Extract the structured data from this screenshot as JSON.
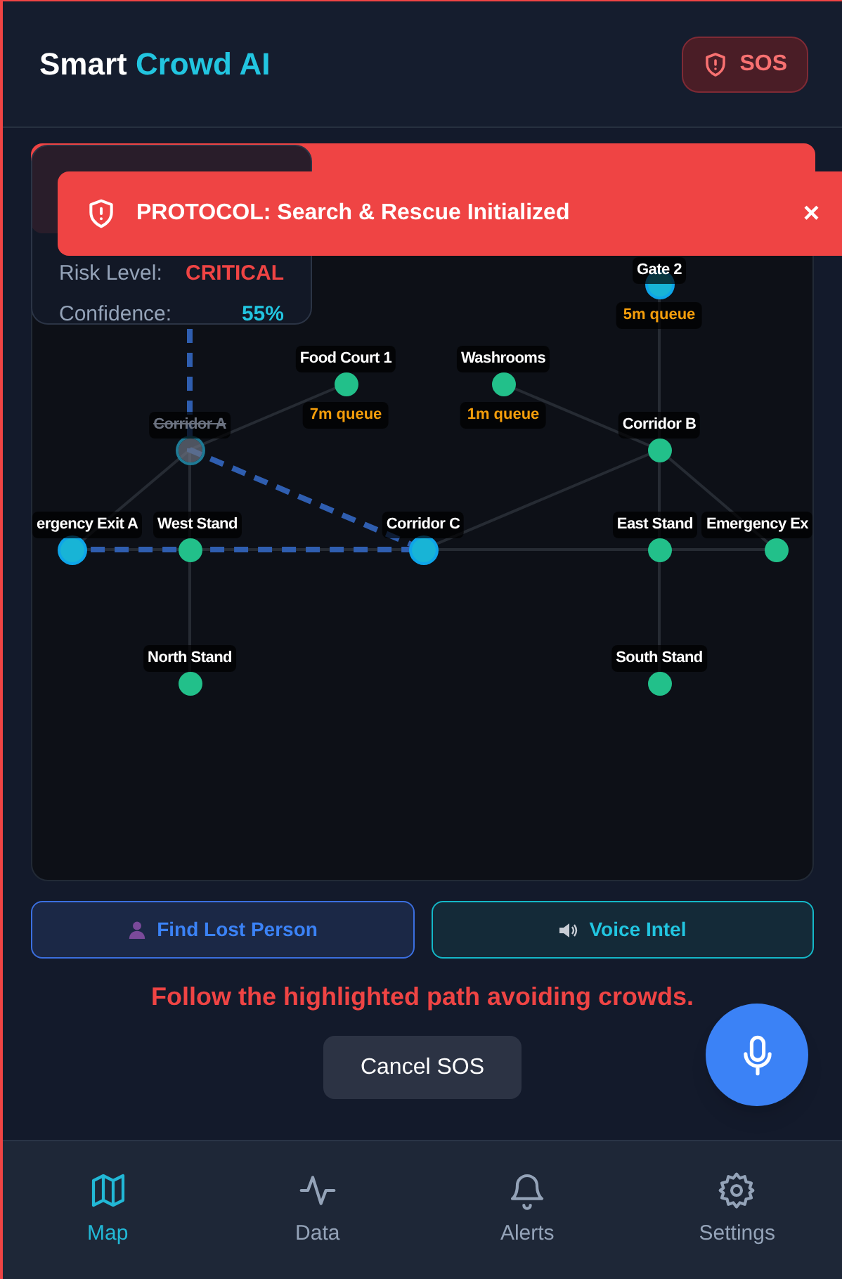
{
  "app_title": {
    "first": "Smart",
    "second": "Crowd AI"
  },
  "sos_button": {
    "label": "SOS",
    "active": true
  },
  "toast": {
    "message": "PROTOCOL: Search & Rescue Initialized",
    "close": "×"
  },
  "analysis_card": {
    "rows": [
      {
        "label": "Risk Level:",
        "value": "CRITICAL",
        "kind": "risk"
      },
      {
        "label": "Confidence:",
        "value": "55%",
        "kind": "confidence"
      }
    ]
  },
  "map": {
    "nodes": [
      {
        "label": "Gate 2",
        "kind": "route",
        "queue": "5m queue"
      },
      {
        "label": "Food Court 1",
        "kind": "normal",
        "queue": "7m queue"
      },
      {
        "label": "Washrooms",
        "kind": "normal",
        "queue": "1m queue"
      },
      {
        "label": "Corridor A",
        "kind": "blocked"
      },
      {
        "label": "Corridor B",
        "kind": "normal"
      },
      {
        "label": "ergency Exit A",
        "kind": "route"
      },
      {
        "label": "West Stand",
        "kind": "normal"
      },
      {
        "label": "Corridor C",
        "kind": "route"
      },
      {
        "label": "East Stand",
        "kind": "normal"
      },
      {
        "label": "Emergency Ex",
        "kind": "normal"
      },
      {
        "label": "North Stand",
        "kind": "normal"
      },
      {
        "label": "South Stand",
        "kind": "normal"
      }
    ]
  },
  "actions": [
    {
      "label": "Find Lost Person",
      "kind": "person"
    },
    {
      "label": "Voice Intel",
      "kind": "voice"
    }
  ],
  "instruction": "Follow the highlighted path avoiding crowds.",
  "cancel_button": "Cancel SOS",
  "nav": [
    {
      "label": "Map",
      "kind": "map",
      "selected": true
    },
    {
      "label": "Data",
      "kind": "data",
      "selected": false
    },
    {
      "label": "Alerts",
      "kind": "alerts",
      "selected": false
    },
    {
      "label": "Settings",
      "kind": "settings",
      "selected": false
    }
  ]
}
